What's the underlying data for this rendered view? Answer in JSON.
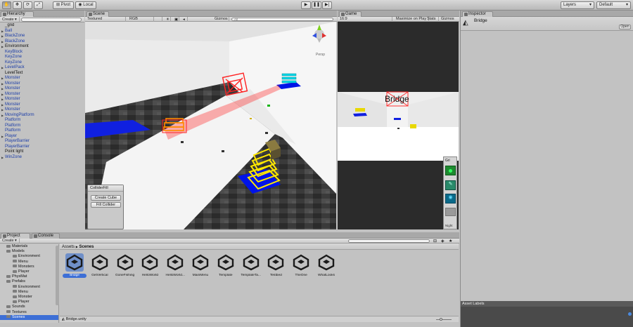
{
  "toolbar": {
    "pivot_label": "Pivot",
    "local_label": "Local",
    "layers_label": "Layers",
    "layout_label": "Default"
  },
  "hierarchy": {
    "tab_label": "Hierarchy",
    "create_label": "Create",
    "items": [
      {
        "label": "_grid",
        "color": "black",
        "arrow": false
      },
      {
        "label": "Ball",
        "color": "blue",
        "arrow": true
      },
      {
        "label": "BlackZone",
        "color": "blue",
        "arrow": true
      },
      {
        "label": "BlackZone",
        "color": "blue",
        "arrow": true
      },
      {
        "label": "Environment",
        "color": "black",
        "arrow": true
      },
      {
        "label": "KeyBlock",
        "color": "blue",
        "arrow": false
      },
      {
        "label": "KeyZone",
        "color": "blue",
        "arrow": false
      },
      {
        "label": "KeyZone",
        "color": "blue",
        "arrow": false
      },
      {
        "label": "LevelPack",
        "color": "blue",
        "arrow": true
      },
      {
        "label": "LevelText",
        "color": "black",
        "arrow": false
      },
      {
        "label": "Monster",
        "color": "blue",
        "arrow": true
      },
      {
        "label": "Monster",
        "color": "blue",
        "arrow": true
      },
      {
        "label": "Monster",
        "color": "blue",
        "arrow": true
      },
      {
        "label": "Monster",
        "color": "blue",
        "arrow": true
      },
      {
        "label": "Monster",
        "color": "blue",
        "arrow": true
      },
      {
        "label": "Monster",
        "color": "blue",
        "arrow": true
      },
      {
        "label": "Monster",
        "color": "blue",
        "arrow": true
      },
      {
        "label": "MovingPlatform",
        "color": "blue",
        "arrow": true
      },
      {
        "label": "Platform",
        "color": "blue",
        "arrow": false
      },
      {
        "label": "Platform",
        "color": "blue",
        "arrow": false
      },
      {
        "label": "Platform",
        "color": "blue",
        "arrow": false
      },
      {
        "label": "Player",
        "color": "blue",
        "arrow": true
      },
      {
        "label": "PlayerBarrier",
        "color": "blue",
        "arrow": false
      },
      {
        "label": "PlayerBarrier",
        "color": "blue",
        "arrow": false
      },
      {
        "label": "Point light",
        "color": "black",
        "arrow": false
      },
      {
        "label": "WinZone",
        "color": "blue",
        "arrow": true
      }
    ]
  },
  "scene": {
    "tab_label": "Scene",
    "render_mode": "Textured",
    "color_mode": "RGB",
    "gizmos_label": "Gizmos",
    "search_placeholder": "All",
    "persp_label": "Persp",
    "collider_panel": {
      "title": "ColliderFill",
      "create_cube_label": "Create Cube",
      "fill_collider_label": "Fill Collider"
    }
  },
  "game": {
    "tab_label": "Game",
    "aspect_label": "16:9",
    "maximize_label": "Maximize on Play",
    "stats_label": "Stats",
    "gizmos_label": "Gizmos",
    "level_text": "Bridge",
    "side_panel_top": "Gri",
    "side_panel_bottom": "Night"
  },
  "inspector": {
    "tab_label": "Inspector",
    "object_name": "Bridge",
    "open_label": "Open",
    "asset_labels_title": "Asset Labels"
  },
  "project": {
    "project_tab": "Project",
    "console_tab": "Console",
    "create_label": "Create",
    "breadcrumb_root": "Assets",
    "breadcrumb_sep": "▶",
    "breadcrumb_current": "Scenes",
    "tree": [
      {
        "label": "Materials",
        "indent": 1
      },
      {
        "label": "Models",
        "indent": 1
      },
      {
        "label": "Environment",
        "indent": 2
      },
      {
        "label": "Menu",
        "indent": 2
      },
      {
        "label": "Monsters",
        "indent": 2
      },
      {
        "label": "Player",
        "indent": 2
      },
      {
        "label": "PhysMat",
        "indent": 1
      },
      {
        "label": "Prefabs",
        "indent": 1
      },
      {
        "label": "Environment",
        "indent": 2
      },
      {
        "label": "Menu",
        "indent": 2
      },
      {
        "label": "Monster",
        "indent": 2
      },
      {
        "label": "Player",
        "indent": 2
      },
      {
        "label": "Sounds",
        "indent": 1
      },
      {
        "label": "Textures",
        "indent": 1
      },
      {
        "label": "Scenes",
        "indent": 1
      }
    ],
    "assets": [
      "Bridge",
      "GetVertical",
      "GoneFishing",
      "HelloWorld",
      "HelloWorld...",
      "MainMenu",
      "Template",
      "TemplateTa...",
      "Testbed",
      "TheOne",
      "WhatLooks"
    ],
    "selected_asset_index": 0,
    "status_file": "Bridge.unity"
  },
  "colors": {
    "selection": "#3d6fd6",
    "hierarchy_link": "#1d3ea8",
    "inspector_bg": "#c2c2c2"
  }
}
